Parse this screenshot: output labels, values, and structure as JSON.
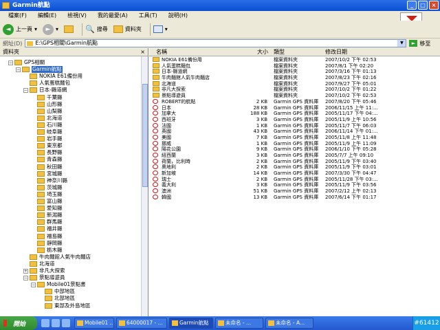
{
  "window": {
    "title": "Garmin航點"
  },
  "menu": [
    "檔案(F)",
    "編輯(E)",
    "檢視(V)",
    "我的最愛(A)",
    "工具(T)",
    "說明(H)"
  ],
  "toolbar": {
    "back": "上一頁",
    "search": "搜尋",
    "folders": "資料夾"
  },
  "address": {
    "label": "網址(D)",
    "path": "E:\\GPS相關\\Garmin航點",
    "go": "移至"
  },
  "left_pane": {
    "title": "資料夾",
    "close": "×"
  },
  "tree": [
    {
      "label": "GPS相關",
      "expander": "−",
      "level": 1
    },
    {
      "label": "Garmin航點",
      "expander": "−",
      "level": 2,
      "selected": true
    },
    {
      "label": "NOKIA E61備份用",
      "expander": "",
      "level": 3
    },
    {
      "label": "人氣蛋糕麵包",
      "expander": "",
      "level": 3
    },
    {
      "label": "日本-縣道網",
      "expander": "−",
      "level": 3
    },
    {
      "label": "千葉縣",
      "expander": "",
      "level": 4
    },
    {
      "label": "山形縣",
      "expander": "",
      "level": 4
    },
    {
      "label": "山梨縣",
      "expander": "",
      "level": 4
    },
    {
      "label": "北海道",
      "expander": "",
      "level": 4
    },
    {
      "label": "石川縣",
      "expander": "",
      "level": 4
    },
    {
      "label": "岐阜縣",
      "expander": "",
      "level": 4
    },
    {
      "label": "岩手縣",
      "expander": "",
      "level": 4
    },
    {
      "label": "東京都",
      "expander": "",
      "level": 4
    },
    {
      "label": "長野縣",
      "expander": "",
      "level": 4
    },
    {
      "label": "青森縣",
      "expander": "",
      "level": 4
    },
    {
      "label": "秋田縣",
      "expander": "",
      "level": 4
    },
    {
      "label": "宮城縣",
      "expander": "",
      "level": 4
    },
    {
      "label": "神奈川縣",
      "expander": "",
      "level": 4
    },
    {
      "label": "茨城縣",
      "expander": "",
      "level": 4
    },
    {
      "label": "埼玉縣",
      "expander": "",
      "level": 4
    },
    {
      "label": "富山縣",
      "expander": "",
      "level": 4
    },
    {
      "label": "愛知縣",
      "expander": "",
      "level": 4
    },
    {
      "label": "新潟縣",
      "expander": "",
      "level": 4
    },
    {
      "label": "群馬縣",
      "expander": "",
      "level": 4
    },
    {
      "label": "福井縣",
      "expander": "",
      "level": 4
    },
    {
      "label": "福島縣",
      "expander": "",
      "level": 4
    },
    {
      "label": "靜岡縣",
      "expander": "",
      "level": 4
    },
    {
      "label": "栃木縣",
      "expander": "",
      "level": 4
    },
    {
      "label": "牛肉麵館人氣牛肉麵店",
      "expander": "",
      "level": 3
    },
    {
      "label": "北海道",
      "expander": "",
      "level": 3
    },
    {
      "label": "非凡大探索",
      "expander": "+",
      "level": 3
    },
    {
      "label": "景點導遊員",
      "expander": "−",
      "level": 3
    },
    {
      "label": "Mobile01景點書",
      "expander": "−",
      "level": 4
    },
    {
      "label": "中部地區",
      "expander": "",
      "level": 5
    },
    {
      "label": "北部地區",
      "expander": "",
      "level": 5
    },
    {
      "label": "東部及外島地區",
      "expander": "",
      "level": 5
    }
  ],
  "columns": {
    "name": "名稱",
    "size": "大小",
    "type": "類型",
    "modified": "修改日期"
  },
  "files": [
    {
      "icon": "folder",
      "name": "NOKIA E61備份用",
      "size": "",
      "type": "檔案資料夾",
      "modified": "2007/10/2 下午 02:53"
    },
    {
      "icon": "folder",
      "name": "人氣蛋糕麵包",
      "size": "",
      "type": "檔案資料夾",
      "modified": "2007/8/1 下午 02:20"
    },
    {
      "icon": "folder",
      "name": "日本-縣道網",
      "size": "",
      "type": "檔案資料夾",
      "modified": "2007/3/16 下午 01:13"
    },
    {
      "icon": "folder",
      "name": "牛肉麵館人氣牛肉麵店",
      "size": "",
      "type": "檔案資料夾",
      "modified": "2007/8/23 下午 02:16"
    },
    {
      "icon": "folder",
      "name": "北海道",
      "size": "",
      "type": "檔案資料夾",
      "modified": "2007/9/27 下午 05:01"
    },
    {
      "icon": "folder",
      "name": "非凡大探索",
      "size": "",
      "type": "檔案資料夾",
      "modified": "2007/10/2 下午 01:22"
    },
    {
      "icon": "folder",
      "name": "景點導遊員",
      "size": "",
      "type": "檔案資料夾",
      "modified": "2007/10/2 下午 02:53"
    },
    {
      "icon": "gps",
      "name": "ROBERT的航點",
      "size": "2 KB",
      "type": "Garmin GPS 資料庫",
      "modified": "2007/8/20 下午 05:46"
    },
    {
      "icon": "gps",
      "name": "日本",
      "size": "28 KB",
      "type": "Garmin GPS 資料庫",
      "modified": "2006/11/15 上午 11:..."
    },
    {
      "icon": "gps",
      "name": "加拿大",
      "size": "188 KB",
      "type": "Garmin GPS 資料庫",
      "modified": "2005/11/17 下午 04:..."
    },
    {
      "icon": "gps",
      "name": "西班牙",
      "size": "3 KB",
      "type": "Garmin GPS 資料庫",
      "modified": "2005/11/9 上午 10:56"
    },
    {
      "icon": "gps",
      "name": "法國",
      "size": "1 KB",
      "type": "Garmin GPS 資料庫",
      "modified": "2005/11/7 下午 06:03"
    },
    {
      "icon": "gps",
      "name": "英國",
      "size": "43 KB",
      "type": "Garmin GPS 資料庫",
      "modified": "2006/11/14 下午 01:..."
    },
    {
      "icon": "gps",
      "name": "美國",
      "size": "7 KB",
      "type": "Garmin GPS 資料庫",
      "modified": "2005/11/8 上午 11:48"
    },
    {
      "icon": "gps",
      "name": "挪威",
      "size": "1 KB",
      "type": "Garmin GPS 資料庫",
      "modified": "2005/11/9 上午 11:09"
    },
    {
      "icon": "gps",
      "name": "陽花公園",
      "size": "9 KB",
      "type": "Garmin GPS 資料庫",
      "modified": "2006/1/10 下午 05:28"
    },
    {
      "icon": "gps",
      "name": "紐西蘭",
      "size": "3 KB",
      "type": "Garmin GPS 資料庫",
      "modified": "2005/7/7 上午 09:10"
    },
    {
      "icon": "gps",
      "name": "荷蘭，比利時",
      "size": "2 KB",
      "type": "Garmin GPS 資料庫",
      "modified": "2005/11/9 下午 03:40"
    },
    {
      "icon": "gps",
      "name": "奧地利",
      "size": "2 KB",
      "type": "Garmin GPS 資料庫",
      "modified": "2005/11/9 下午 03:01"
    },
    {
      "icon": "gps",
      "name": "新加坡",
      "size": "14 KB",
      "type": "Garmin GPS 資料庫",
      "modified": "2007/3/30 下午 04:47"
    },
    {
      "icon": "gps",
      "name": "瑞士",
      "size": "2 KB",
      "type": "Garmin GPS 資料庫",
      "modified": "2005/11/28 下午 03:..."
    },
    {
      "icon": "gps",
      "name": "義大利",
      "size": "3 KB",
      "type": "Garmin GPS 資料庫",
      "modified": "2005/11/9 下午 03:56"
    },
    {
      "icon": "gps",
      "name": "澳洲",
      "size": "51 KB",
      "type": "Garmin GPS 資料庫",
      "modified": "2007/2/12 上午 02:13"
    },
    {
      "icon": "gps",
      "name": "韓國",
      "size": "13 KB",
      "type": "Garmin GPS 資料庫",
      "modified": "2007/6/14 下午 01:17"
    }
  ],
  "taskbar": {
    "start": "開始",
    "tasks": [
      "Mobile01 ...",
      "64000017 - ...",
      "Garmin航點",
      "未命名 - ...",
      "未命名 - A..."
    ],
    "tray": "#61412"
  },
  "colors": {
    "titlebar": "#0a4fd0",
    "selection": "#316ac5",
    "folder": "#f0c040",
    "taskbar": "#2458d0"
  }
}
